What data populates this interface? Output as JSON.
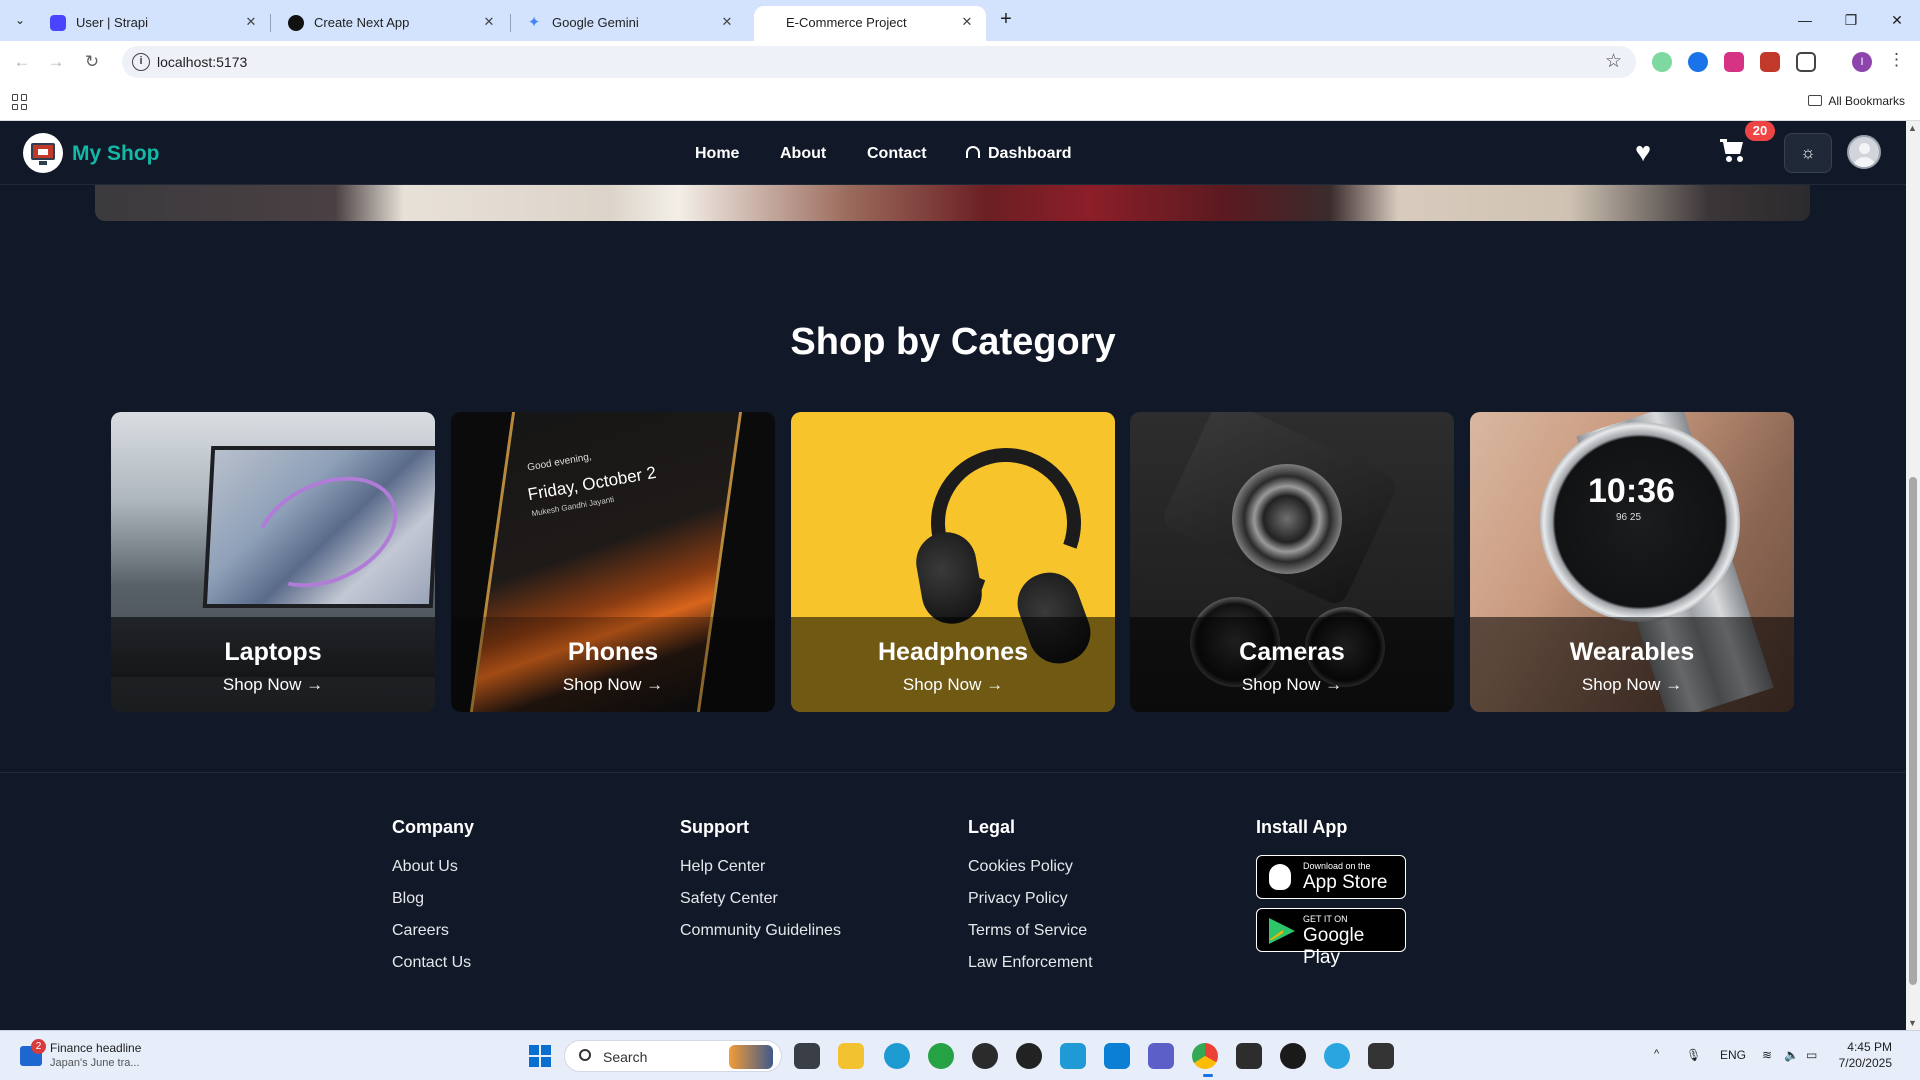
{
  "browser": {
    "tabs": [
      {
        "title": "User | Strapi"
      },
      {
        "title": "Create Next App"
      },
      {
        "title": "Google Gemini"
      },
      {
        "title": "E-Commerce Project"
      }
    ],
    "url": "localhost:5173",
    "bookmarks_label": "All Bookmarks"
  },
  "navbar": {
    "brand": "My Shop",
    "links": [
      "Home",
      "About",
      "Contact",
      "Dashboard"
    ],
    "cart_count": "20"
  },
  "categories_section": {
    "title": "Shop by Category",
    "cta": "Shop Now →",
    "items": [
      {
        "name": "Laptops"
      },
      {
        "name": "Phones",
        "image_text": [
          "Good evening,",
          "Friday, October 2",
          "Mukesh Gandhi Jayanti"
        ]
      },
      {
        "name": "Headphones"
      },
      {
        "name": "Cameras"
      },
      {
        "name": "Wearables",
        "image_text": [
          "10:36",
          "96 25"
        ]
      }
    ]
  },
  "footer": {
    "columns": [
      {
        "heading": "Company",
        "links": [
          "About Us",
          "Blog",
          "Careers",
          "Contact Us"
        ]
      },
      {
        "heading": "Support",
        "links": [
          "Help Center",
          "Safety Center",
          "Community Guidelines"
        ]
      },
      {
        "heading": "Legal",
        "links": [
          "Cookies Policy",
          "Privacy Policy",
          "Terms of Service",
          "Law Enforcement"
        ]
      }
    ],
    "install_app": {
      "heading": "Install App",
      "app_store": {
        "small": "Download on the",
        "large": "App Store"
      },
      "google_play": {
        "small": "GET IT ON",
        "large": "Google Play"
      }
    }
  },
  "taskbar": {
    "news_title": "Finance headline",
    "news_subtitle": "Japan's June tra...",
    "news_badge": "2",
    "search_label": "Search",
    "lang": "ENG",
    "time": "4:45 PM",
    "date": "7/20/2025"
  },
  "colors": {
    "page_bg": "#111827",
    "brand": "#14b8a6",
    "badge": "#ef4444"
  }
}
